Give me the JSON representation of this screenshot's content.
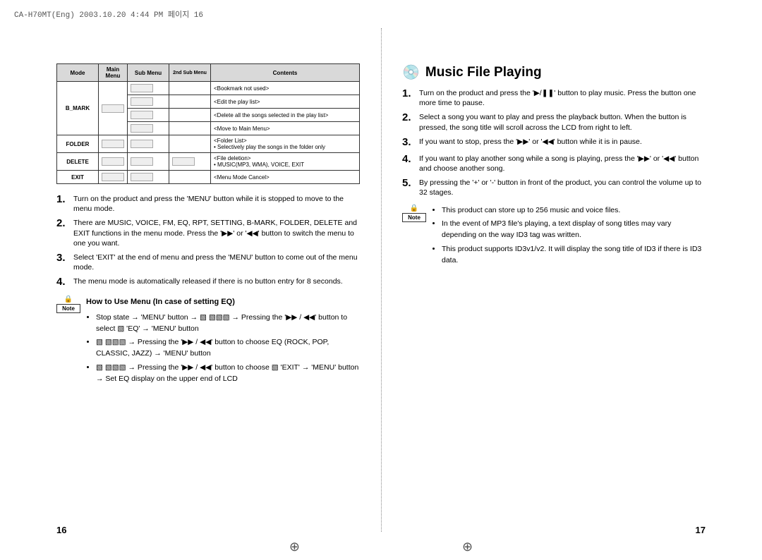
{
  "header": "CA-H70MT(Eng)  2003.10.20  4:44 PM  페이지 16",
  "table": {
    "headers": [
      "Mode",
      "Main Menu",
      "Sub Menu",
      "2nd Sub Menu",
      "Contents"
    ],
    "rows": [
      {
        "mode": "B_MARK",
        "rowspan": 4,
        "contents": "<Bookmark not used>"
      },
      {
        "contents": "<Edit the play list>"
      },
      {
        "contents": "<Delete all the songs selected in the play list>"
      },
      {
        "contents": "<Move to Main Menu>"
      },
      {
        "mode": "FOLDER",
        "rowspan": 1,
        "contents_title": "<Folder List>",
        "contents_bullet": "Selectively play the songs in the folder only"
      },
      {
        "mode": "DELETE",
        "rowspan": 1,
        "contents_title": "<File deletion>",
        "contents_bullet": "MUSIC(MP3, WMA), VOICE, EXIT"
      },
      {
        "mode": "EXIT",
        "rowspan": 1,
        "contents": "<Menu Mode Cancel>"
      }
    ]
  },
  "left_steps": [
    "Turn on the product and press the 'MENU' button while it is stopped to move to the menu mode.",
    "There are MUSIC, VOICE, FM, EQ, RPT, SETTING, B-MARK, FOLDER, DELETE  and EXIT functions in the menu mode.  Press the '▶▶' or '◀◀' button to switch the menu to one you want.",
    "Select 'EXIT' at the end of menu and press the 'MENU' button to come out of the menu mode.",
    "The menu mode is automatically released if there is no button entry for 8 seconds."
  ],
  "left_note": {
    "label": "Note",
    "title": "How to Use Menu (In case of setting EQ)",
    "items": [
      "Stop state → 'MENU' button → ▧ ▧▧▧ → Pressing the '▶▶ / ◀◀' button to select  ▧ 'EQ' → 'MENU' button",
      "▧ ▧▧▧ → Pressing the '▶▶ / ◀◀' button to choose EQ (ROCK, POP, CLASSIC, JAZZ) → 'MENU' button",
      "▧ ▧▧▧ → Pressing the '▶▶ / ◀◀' button to choose ▧ 'EXIT' → 'MENU' button → Set EQ display on the upper end of LCD"
    ]
  },
  "right_title": "Music File Playing",
  "right_steps": [
    "Turn on the product and press the '▶/❚❚' button to play music. Press the button one more time to pause.",
    "Select a song you want to play and press the playback button.  When the button is pressed, the song title will scroll across the LCD from right to left.",
    "If you want to stop, press the '▶▶' or '◀◀' button while it is in pause.",
    "If you want to play another song while a song is playing, press the '▶▶' or '◀◀' button and choose another song.",
    "By pressing the '+' or '-' button in front of the product, you can control the volume up to 32 stages."
  ],
  "right_note": {
    "label": "Note",
    "items": [
      "This product can store up to 256 music and voice files.",
      "In the event of MP3 file's playing, a text display of song titles may vary depending on the way ID3 tag was written.",
      "This product supports ID3v1/v2.  It will display the song title of ID3 if there is ID3 data."
    ]
  },
  "page_left": "16",
  "page_right": "17"
}
